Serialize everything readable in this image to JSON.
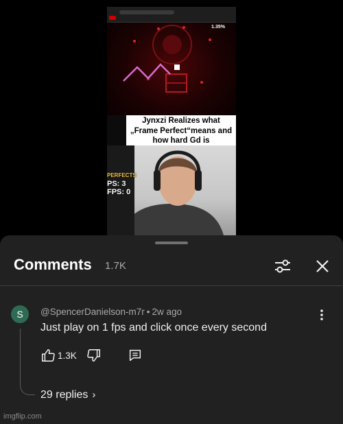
{
  "video": {
    "progress_label": "1.35%",
    "caption_lines": [
      "Jynxzi Realizes what",
      "„Frame Perfect“means and",
      "how hard Gd is"
    ],
    "overlay_lines": [
      "PERFECTS",
      "PS: 3",
      "FPS: 0"
    ]
  },
  "comments_panel": {
    "title": "Comments",
    "count": "1.7K"
  },
  "comment": {
    "avatar_letter": "S",
    "avatar_color": "#2e6b55",
    "author": "@SpencerDanielson-m7r",
    "separator": "•",
    "time": "2w ago",
    "text": "Just play on 1 fps and click once every second",
    "likes": "1.3K",
    "replies_label": "29 replies"
  },
  "watermark": "imgflip.com",
  "icons": [
    "filter-icon",
    "close-icon",
    "more-vert-icon",
    "thumb-up-icon",
    "thumb-down-icon",
    "reply-icon",
    "chevron-right-icon"
  ]
}
